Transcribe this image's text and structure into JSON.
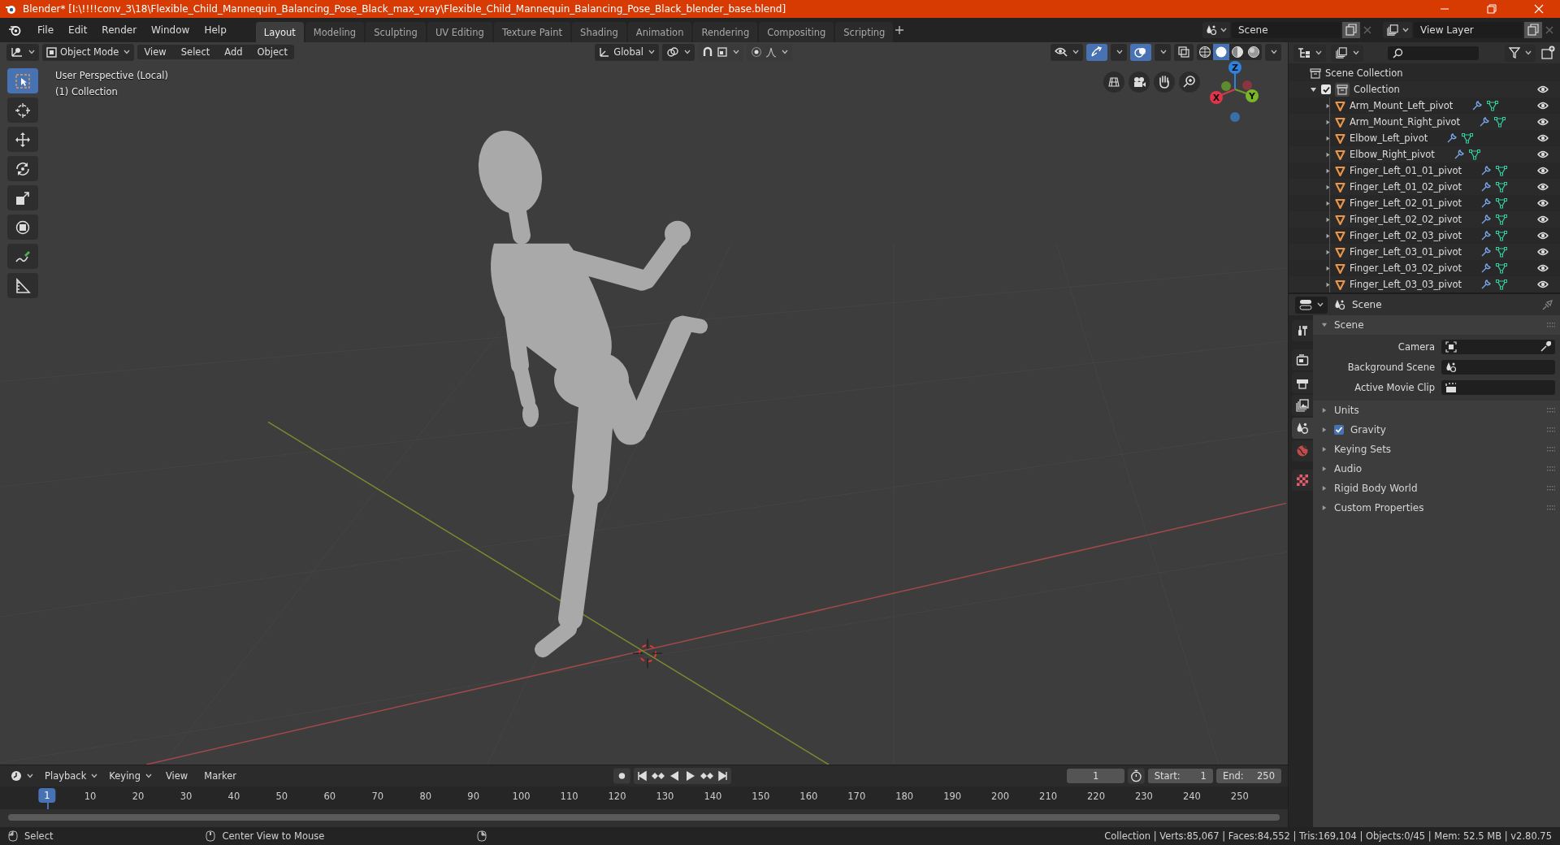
{
  "window": {
    "title": "Blender* [I:\\!!!!conv_3\\18\\Flexible_Child_Mannequin_Balancing_Pose_Black_max_vray\\Flexible_Child_Mannequin_Balancing_Pose_Black_blender_base.blend]"
  },
  "menu": [
    "File",
    "Edit",
    "Render",
    "Window",
    "Help"
  ],
  "workspaces": [
    {
      "label": "Layout",
      "selected": true
    },
    {
      "label": "Modeling",
      "selected": false
    },
    {
      "label": "Sculpting",
      "selected": false
    },
    {
      "label": "UV Editing",
      "selected": false
    },
    {
      "label": "Texture Paint",
      "selected": false
    },
    {
      "label": "Shading",
      "selected": false
    },
    {
      "label": "Animation",
      "selected": false
    },
    {
      "label": "Rendering",
      "selected": false
    },
    {
      "label": "Compositing",
      "selected": false
    },
    {
      "label": "Scripting",
      "selected": false
    }
  ],
  "scene_selector": {
    "value": "Scene"
  },
  "view_layer_selector": {
    "value": "View Layer"
  },
  "viewport": {
    "mode": "Object Mode",
    "menus": [
      "View",
      "Select",
      "Add",
      "Object"
    ],
    "orientation": "Global",
    "snap": {
      "on": false
    },
    "proportional_editing": {
      "on": false
    },
    "tools": [
      {
        "kind": "select",
        "selected": true
      },
      {
        "kind": "cursor",
        "selected": false
      },
      {
        "kind": "move",
        "selected": false
      },
      {
        "kind": "rotate",
        "selected": false
      },
      {
        "kind": "scale",
        "selected": false
      },
      {
        "kind": "transform",
        "selected": false
      },
      {
        "kind": "annotate",
        "selected": false
      },
      {
        "kind": "measure",
        "selected": false
      }
    ],
    "overlay_text": [
      "User Perspective (Local)",
      "(1) Collection"
    ],
    "gizmo_axes": [
      "Z",
      "X",
      "Y"
    ]
  },
  "outliner": {
    "root": "Scene Collection",
    "items": [
      {
        "label": "Collection",
        "expanded": true,
        "checked": true,
        "children": [
          {
            "label": "Arm_Mount_Left_pivot",
            "expanded": false
          },
          {
            "label": "Arm_Mount_Right_pivot",
            "expanded": false
          },
          {
            "label": "Elbow_Left_pivot",
            "expanded": false
          },
          {
            "label": "Elbow_Right_pivot",
            "expanded": false
          },
          {
            "label": "Finger_Left_01_01_pivot",
            "expanded": false
          },
          {
            "label": "Finger_Left_01_02_pivot",
            "expanded": false
          },
          {
            "label": "Finger_Left_02_01_pivot",
            "expanded": false
          },
          {
            "label": "Finger_Left_02_02_pivot",
            "expanded": false
          },
          {
            "label": "Finger_Left_02_03_pivot",
            "expanded": false
          },
          {
            "label": "Finger_Left_03_01_pivot",
            "expanded": false
          },
          {
            "label": "Finger_Left_03_02_pivot",
            "expanded": false
          },
          {
            "label": "Finger_Left_03_03_pivot",
            "expanded": false
          }
        ]
      }
    ]
  },
  "properties": {
    "header": "Scene",
    "tabs": [
      {
        "kind": "tool",
        "selected": false
      },
      {
        "kind": "render",
        "selected": false
      },
      {
        "kind": "output",
        "selected": false
      },
      {
        "kind": "view_layer",
        "selected": false
      },
      {
        "kind": "scene",
        "selected": true
      },
      {
        "kind": "world",
        "selected": false
      },
      {
        "kind": "texture",
        "selected": false
      }
    ],
    "panels": [
      {
        "label": "Scene",
        "expanded": true,
        "fields": [
          {
            "label": "Camera",
            "kind": "camera"
          },
          {
            "label": "Background Scene",
            "kind": "scene"
          },
          {
            "label": "Active Movie Clip",
            "kind": "clip"
          }
        ]
      },
      {
        "label": "Units",
        "expanded": false
      },
      {
        "label": "Gravity",
        "expanded": false,
        "checkbox": {
          "checked": true
        }
      },
      {
        "label": "Keying Sets",
        "expanded": false
      },
      {
        "label": "Audio",
        "expanded": false
      },
      {
        "label": "Rigid Body World",
        "expanded": false
      },
      {
        "label": "Custom Properties",
        "expanded": false
      }
    ]
  },
  "timeline": {
    "dropdowns": [
      "Playback",
      "Keying"
    ],
    "menus": [
      "View",
      "Marker"
    ],
    "current_frame": "1",
    "start": {
      "label": "Start:",
      "value": "1"
    },
    "end": {
      "label": "End:",
      "value": "250"
    },
    "ruler": [
      {
        "label": "1",
        "selected": true
      },
      {
        "label": "10",
        "selected": false
      },
      {
        "label": "20",
        "selected": false
      },
      {
        "label": "30",
        "selected": false
      },
      {
        "label": "40",
        "selected": false
      },
      {
        "label": "50",
        "selected": false
      },
      {
        "label": "60",
        "selected": false
      },
      {
        "label": "70",
        "selected": false
      },
      {
        "label": "80",
        "selected": false
      },
      {
        "label": "90",
        "selected": false
      },
      {
        "label": "100",
        "selected": false
      },
      {
        "label": "110",
        "selected": false
      },
      {
        "label": "120",
        "selected": false
      },
      {
        "label": "130",
        "selected": false
      },
      {
        "label": "140",
        "selected": false
      },
      {
        "label": "150",
        "selected": false
      },
      {
        "label": "160",
        "selected": false
      },
      {
        "label": "170",
        "selected": false
      },
      {
        "label": "180",
        "selected": false
      },
      {
        "label": "190",
        "selected": false
      },
      {
        "label": "200",
        "selected": false
      },
      {
        "label": "210",
        "selected": false
      },
      {
        "label": "220",
        "selected": false
      },
      {
        "label": "230",
        "selected": false
      },
      {
        "label": "240",
        "selected": false
      },
      {
        "label": "250",
        "selected": false
      }
    ]
  },
  "status_bar": {
    "hints": [
      "Select",
      "Center View to Mouse"
    ],
    "stats": "Collection | Verts:85,067 | Faces:84,552 | Tris:169,104 | Objects:0/45 | Mem: 52.5 MB | v2.80.75"
  }
}
